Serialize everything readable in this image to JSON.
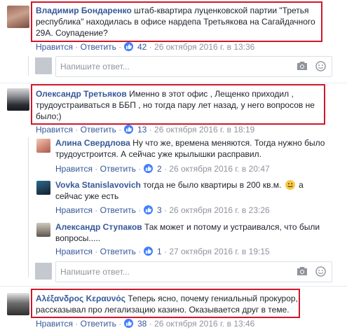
{
  "comments": [
    {
      "author": "Владимир Бондаренко",
      "text_lines": [
        "штаб-квартира луценковской партии \"Третья",
        "республика\" находилась в офисе нардепа Третьякова на Сагайдачного",
        "29А. Соупадение?"
      ],
      "like_label": "Нравится",
      "reply_label": "Ответить",
      "likes": "42",
      "timestamp": "26 октября 2016 г. в 13:36"
    },
    {
      "author": "Олександр Третьяков",
      "text_lines": [
        "Именно в этот офис , Лещенко приходил ,",
        "трудоустраиваться в ББП , но тогда пару лет назад, у него вопросов не",
        "было;)"
      ],
      "like_label": "Нравится",
      "reply_label": "Ответить",
      "likes": "13",
      "timestamp": "26 октября 2016 г. в 18:19",
      "replies": [
        {
          "author": "Алина Свердлова",
          "text_lines": [
            "Ну что же, времена меняются. Тогда нужно было",
            "трудоустроится. А сейчас уже крылышки расправил."
          ],
          "like_label": "Нравится",
          "reply_label": "Ответить",
          "likes": "2",
          "timestamp": "26 октября 2016 г. в 20:47"
        },
        {
          "author": "Vovka Stanislavovich",
          "text_lines": [
            "тогда не было квартиры в 200 кв.м.",
            "а",
            "сейчас уже есть"
          ],
          "like_label": "Нравится",
          "reply_label": "Ответить",
          "likes": "3",
          "timestamp": "26 октября 2016 г. в 23:26"
        },
        {
          "author": "Александр Ступаков",
          "text_lines": [
            "Так может и потому и устраивался, что были",
            "вопросы....."
          ],
          "like_label": "Нравится",
          "reply_label": "Ответить",
          "likes": "1",
          "timestamp": "27 октября 2016 г. в 19:15"
        }
      ]
    },
    {
      "author": "Αλέξανδρος Κεραυνός",
      "text_lines": [
        "Теперь ясно, почему гениальный прокурор,",
        "рассказывал про легализацию казино. Оказывается друг в теме."
      ],
      "like_label": "Нравится",
      "reply_label": "Ответить",
      "likes": "38",
      "timestamp": "26 октября 2016 г. в 13:46"
    }
  ],
  "reply_placeholder": "Напишите ответ...",
  "icons": {
    "like": "thumbs-up-icon",
    "camera": "camera-icon",
    "emoji": "smiley-icon"
  },
  "colors": {
    "link": "#365899",
    "meta": "#90949c",
    "like_badge": "#4080ff",
    "highlight_box": "#d0172b"
  }
}
